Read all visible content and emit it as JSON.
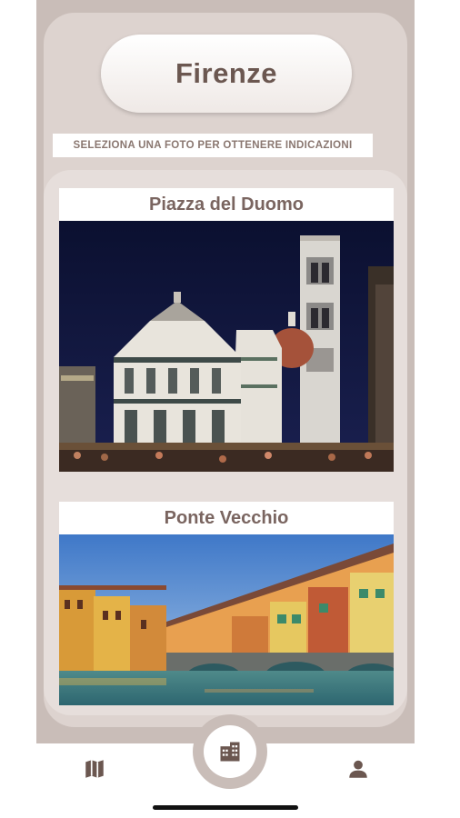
{
  "header": {
    "city_title": "Firenze"
  },
  "instruction": "SELEZIONA UNA FOTO PER OTTENERE INDICAZIONI",
  "places": [
    {
      "name": "Piazza del Duomo"
    },
    {
      "name": "Ponte Vecchio"
    }
  ],
  "nav": {
    "items": [
      {
        "icon": "map-icon"
      },
      {
        "icon": "buildings-icon",
        "active": true
      },
      {
        "icon": "user-icon"
      }
    ]
  },
  "colors": {
    "accent": "#6b5750",
    "panel": "#ddd3cf",
    "frame": "#c9bdb8"
  }
}
